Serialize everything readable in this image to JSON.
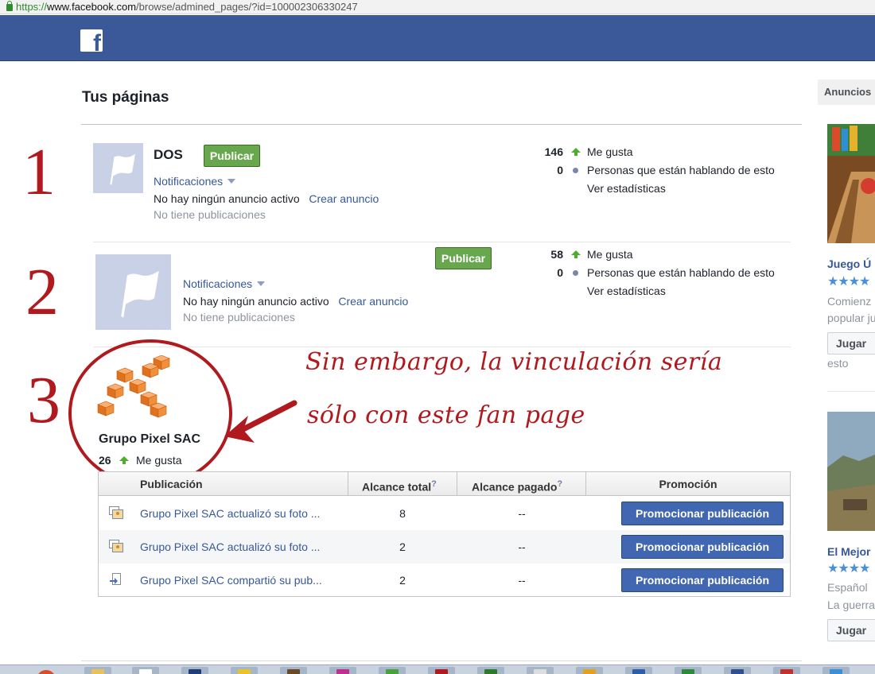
{
  "browser": {
    "url_scheme": "https://",
    "url_host": "www.facebook.com",
    "url_path": "/browse/admined_pages/?id=100002306330247"
  },
  "header": {
    "logo_letter": "f"
  },
  "main": {
    "title": "Tus páginas",
    "pages": [
      {
        "number": "1",
        "name": "DOS",
        "publish_label": "Publicar",
        "notifications_label": "Notificaciones",
        "ads_status": "No hay ningún anuncio activo",
        "create_ad_label": "Crear anuncio",
        "posts_status": "No tiene publicaciones",
        "likes_count": "146",
        "likes_label": "Me gusta",
        "talking_count": "0",
        "talking_label": "Personas que están hablando de esto",
        "stats_label": "Ver estadísticas"
      },
      {
        "number": "2",
        "name": "",
        "publish_label": "Publicar",
        "notifications_label": "Notificaciones",
        "ads_status": "No hay ningún anuncio activo",
        "create_ad_label": "Crear anuncio",
        "posts_status": "No tiene publicaciones",
        "likes_count": "58",
        "likes_label": "Me gusta",
        "talking_count": "0",
        "talking_label": "Personas que están hablando de esto",
        "stats_label": "Ver estadísticas"
      },
      {
        "number": "3",
        "name": "Grupo Pixel SAC",
        "likes_count": "26",
        "likes_label": "Me gusta"
      }
    ],
    "annotation": {
      "line1": "Sin embargo, la vinculación sería",
      "line2": "sólo con este fan page"
    },
    "posts_table": {
      "headers": {
        "post": "Publicación",
        "total_reach": "Alcance total",
        "paid_reach": "Alcance pagado",
        "promotion": "Promoción",
        "help_mark": "?"
      },
      "rows": [
        {
          "text": "Grupo Pixel SAC actualizó su foto ...",
          "total_reach": "8",
          "paid_reach": "--",
          "button": "Promocionar publicación",
          "icon": "photo-icon"
        },
        {
          "text": "Grupo Pixel SAC actualizó su foto ...",
          "total_reach": "2",
          "paid_reach": "--",
          "button": "Promocionar publicación",
          "icon": "photo-icon"
        },
        {
          "text": "Grupo Pixel SAC compartió su pub...",
          "total_reach": "2",
          "paid_reach": "--",
          "button": "Promocionar publicación",
          "icon": "share-icon"
        }
      ]
    }
  },
  "sidebar": {
    "heading": "Anuncios",
    "ads": [
      {
        "title": "Juego Ú",
        "stars": "★★★★",
        "text1": "Comienz",
        "text2": "popular ju",
        "button": "Jugar",
        "footer": "esto"
      },
      {
        "title": "El Mejor",
        "stars": "★★★★",
        "text1": "Español",
        "text2": "La guerra",
        "button": "Jugar"
      }
    ]
  },
  "colors": {
    "facebook_blue": "#3b5998",
    "annotation_red": "#b0191e",
    "publish_green": "#69a74e",
    "promote_blue": "#4267b2"
  }
}
